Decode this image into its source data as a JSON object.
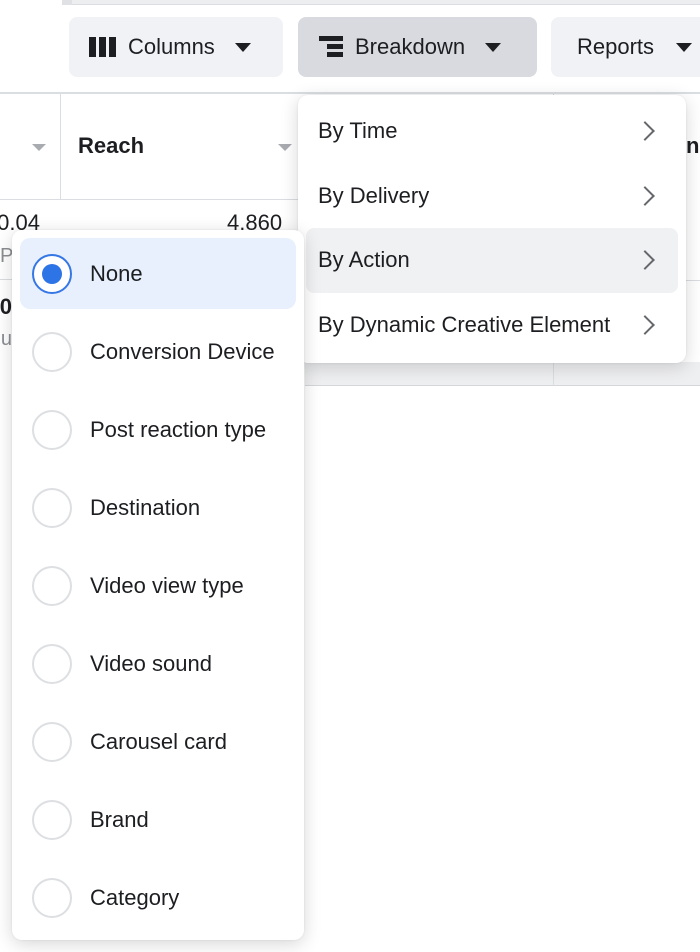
{
  "toolbar": {
    "columns": {
      "label": "Columns",
      "icon": "columns-icon"
    },
    "breakdown": {
      "label": "Breakdown",
      "icon": "breakdown-icon",
      "active": true
    },
    "reports": {
      "label": "Reports"
    }
  },
  "table": {
    "headers": [
      {
        "label": ""
      },
      {
        "label": "Reach"
      },
      {
        "label": "ns"
      }
    ],
    "rows": [
      {
        "col0_value": "0.04",
        "col0_sub": "P",
        "reach": "4,860"
      },
      {
        "col0_value": "0",
        "col0_sub": "u"
      }
    ]
  },
  "breakdown_menu": {
    "items": [
      {
        "label": "By Time",
        "has_submenu": true
      },
      {
        "label": "By Delivery",
        "has_submenu": true
      },
      {
        "label": "By Action",
        "has_submenu": true,
        "hovered": true
      },
      {
        "label": "By Dynamic Creative Element",
        "has_submenu": true
      }
    ]
  },
  "action_menu": {
    "selected": "None",
    "options": [
      {
        "label": "None",
        "checked": true
      },
      {
        "label": "Conversion Device",
        "checked": false
      },
      {
        "label": "Post reaction type",
        "checked": false
      },
      {
        "label": "Destination",
        "checked": false
      },
      {
        "label": "Video view type",
        "checked": false
      },
      {
        "label": "Video sound",
        "checked": false
      },
      {
        "label": "Carousel card",
        "checked": false
      },
      {
        "label": "Brand",
        "checked": false
      },
      {
        "label": "Category",
        "checked": false
      }
    ]
  },
  "colors": {
    "accent": "#2d74e6",
    "selected_bg": "#e8f0fd",
    "button_bg": "#f0f2f5",
    "button_active_bg": "#d8dadf",
    "hover_bg": "#f0f1f3"
  }
}
